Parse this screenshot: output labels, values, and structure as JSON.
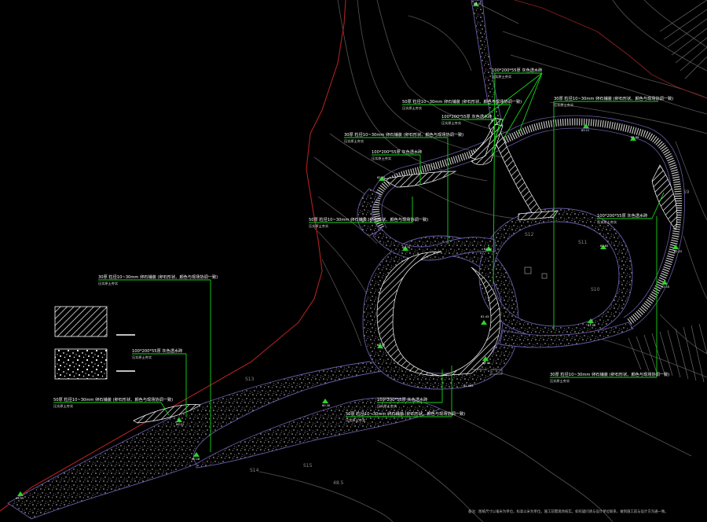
{
  "colors": {
    "background": "#000000",
    "contour": "#5a5a5a",
    "boundary": "#b32222",
    "leader": "#18d418",
    "path_edge": "#6a5aa8",
    "gravel": "#bfbfbf",
    "hatch": "#ffffff",
    "marker": "#2bd42b"
  },
  "callouts": {
    "c1_line1": "100*200*55厚 灰色透水砖",
    "c1_line2": "压实原土夯实",
    "c2_line1": "50厚 粒径10~30mm 卵石铺装 (卵石形状、颜色与现场协调一致)",
    "c2_line2": "压实原土夯实",
    "c3_line1": "100*200*55厚 灰色透水砖",
    "c3_line2": "压实原土夯实",
    "c4_line1": "30厚 粒径10~30mm 卵石铺装 (卵石形状、颜色与现场协调一致)",
    "c4_line2": "压实原土夯实",
    "c5_line1": "100*200*55厚 灰色透水砖",
    "c5_line2": "压实原土夯实",
    "c6_line1": "30厚 粒径10~30mm 卵石铺装 (卵石形状、颜色与现场协调一致)",
    "c6_line2": "压实原土夯实",
    "c7_line1": "50厚 粒径10~30mm 卵石铺装 (卵石形状、颜色与现场协调一致)",
    "c7_line2": "压实原土夯实",
    "c8_line1": "100*200*55厚 灰色透水砖",
    "c8_line2": "压实原土夯实",
    "c9_line1": "30厚 粒径10~30mm 卵石铺装 (卵石形状、颜色与现场协调一致)",
    "c9_line2": "压实原土夯实",
    "c10_line1": "100*200*55厚 灰色透水砖",
    "c10_line2": "压实原土夯实",
    "c11_line1": "50厚 粒径10~30mm 卵石铺装 (卵石形状、颜色与现场协调一致)",
    "c11_line2": "压实原土夯实",
    "c12_line1": "100*200*55厚 灰色透水砖",
    "c12_line2": "压实原土夯实",
    "c13_line1": "30厚 粒径10~30mm 卵石铺装 (卵石形状、颜色与现场协调一致)",
    "c13_line2": "压实原土夯实",
    "c14_line1": "50厚 粒径10~30mm 卵石铺装 (卵石形状、颜色与现场协调一致)",
    "c14_line2": "压实原土夯实"
  },
  "elevations": {
    "e_top": "64.55",
    "e_ne1": "63.21",
    "e_ne2": "62.99",
    "e_e1": "62.22",
    "e_e2": "62.10",
    "e_ring_b": "61.50",
    "e_ring_c": "61.65",
    "e_mid1": "61.43",
    "e_mid2": "61.12",
    "e_mid3": "61.70",
    "e_spur": "62.20",
    "e_w1": "61.19",
    "e_w2": "61.10",
    "e_s1": "60.30",
    "e_s2": "60.12",
    "e_s3": "60.18",
    "e_sw": "59.55"
  },
  "zones": {
    "z1": "S13",
    "z2": "S14",
    "z3": "S15",
    "z4": "S12",
    "z5": "S11",
    "z6": "S9",
    "z7": "S10",
    "z8": "48.5"
  },
  "legend": {
    "hatch_label": "",
    "gravel_label": ""
  },
  "footnote": "备注：图纸尺寸以毫米为单位，标高以米为单位，施工前需现场核实。如有疑问请与设计单位联系，做到施工前与设计方沟通一致。",
  "road_elev": "61.565"
}
